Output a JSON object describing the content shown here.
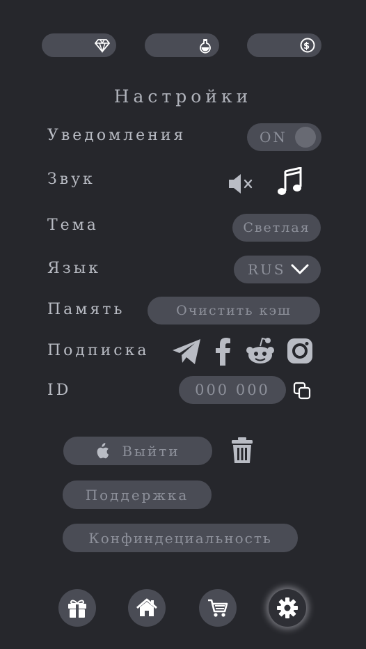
{
  "colors": {
    "background": "#26272c",
    "pill": "#4a4c55",
    "pill_text": "#8d909a",
    "label_text": "#b9bcc4",
    "icon_light": "#ffffff",
    "icon_gray": "#b9bcc4"
  },
  "top_bar": {
    "currencies": [
      {
        "icon": "diamond-icon",
        "value": ""
      },
      {
        "icon": "potion-icon",
        "value": ""
      },
      {
        "icon": "coin-icon",
        "value": ""
      }
    ]
  },
  "settings": {
    "title": "Настройки",
    "notifications": {
      "label": "Уведомления",
      "toggle_text": "ON"
    },
    "sound": {
      "label": "Звук",
      "icons": [
        "mute-icon",
        "music-note-icon"
      ]
    },
    "theme": {
      "label": "Тема",
      "value": "Светлая"
    },
    "language": {
      "label": "Язык",
      "value": "RUS"
    },
    "memory": {
      "label": "Память",
      "button": "Очистить кэш"
    },
    "subscription": {
      "label": "Подписка",
      "icons": [
        "telegram-icon",
        "facebook-icon",
        "reddit-icon",
        "instagram-icon"
      ]
    },
    "id": {
      "label": "ID",
      "value": "000 000"
    }
  },
  "actions": {
    "logout": "Выйти",
    "support": "Поддержка",
    "privacy": "Конфиндециальность"
  },
  "bottom_nav": {
    "items": [
      "gift-icon",
      "home-icon",
      "cart-icon",
      "settings-icon"
    ],
    "active": "settings-icon"
  }
}
